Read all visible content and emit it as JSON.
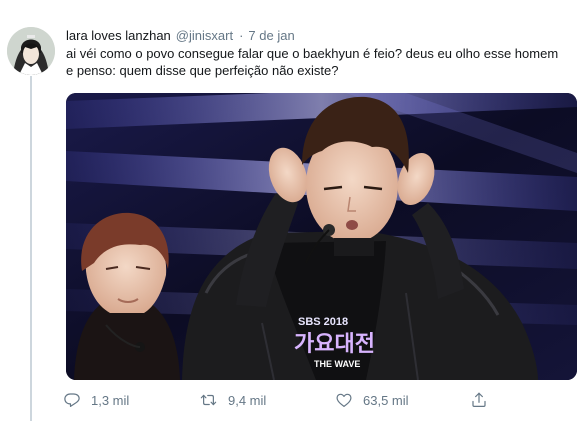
{
  "tweet": {
    "display_name": "lara loves lanzhan",
    "handle": "@jinisxart",
    "separator": "·",
    "date": "7 de jan",
    "text_line1": "ai véi como o povo consegue falar que o baekhyun é feio? deus eu olho esse homem",
    "text_line2": "e penso: quem disse que perfeição não existe?"
  },
  "media": {
    "badge_top": "SBS 2018",
    "badge_main": "가요대전",
    "badge_sub": "THE WAVE"
  },
  "actions": {
    "replies": "1,3 mil",
    "retweets": "9,4 mil",
    "likes": "63,5 mil"
  },
  "colors": {
    "text": "#14171a",
    "secondary": "#657786",
    "thread_line": "#cdd6dd"
  },
  "icons": [
    "reply-icon",
    "retweet-icon",
    "like-icon",
    "share-icon"
  ]
}
